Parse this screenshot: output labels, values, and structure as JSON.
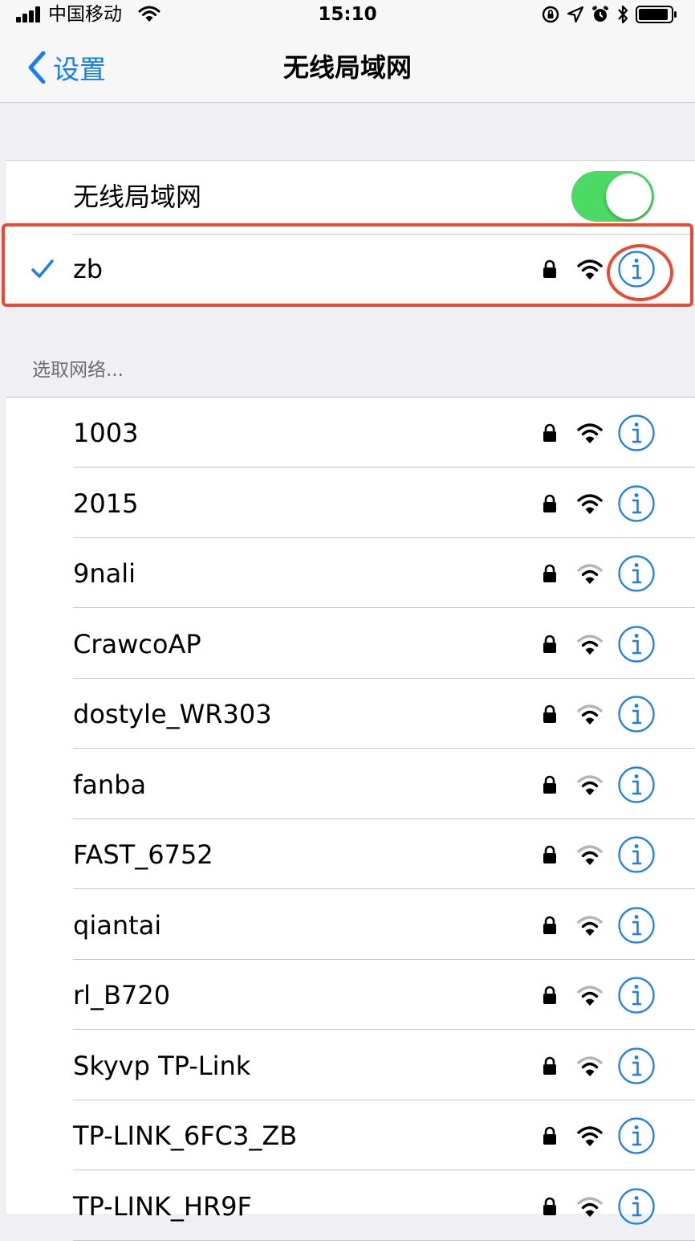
{
  "status_bar": {
    "carrier": "中国移动",
    "time": "15:10"
  },
  "nav": {
    "back_label": "设置",
    "title": "无线局域网"
  },
  "wifi_toggle": {
    "label": "无线局域网",
    "on": true
  },
  "connected_network": {
    "name": "zb",
    "secured": true,
    "signal_bars": 3
  },
  "networks_header": "选取网络...",
  "networks": [
    {
      "name": "1003",
      "secured": true,
      "signal_bars": 3
    },
    {
      "name": "2015",
      "secured": true,
      "signal_bars": 3
    },
    {
      "name": "9nali",
      "secured": true,
      "signal_bars": 2
    },
    {
      "name": "CrawcoAP",
      "secured": true,
      "signal_bars": 2
    },
    {
      "name": "dostyle_WR303",
      "secured": true,
      "signal_bars": 2
    },
    {
      "name": "fanba",
      "secured": true,
      "signal_bars": 2
    },
    {
      "name": "FAST_6752",
      "secured": true,
      "signal_bars": 2
    },
    {
      "name": "qiantai",
      "secured": true,
      "signal_bars": 2
    },
    {
      "name": "rl_B720",
      "secured": true,
      "signal_bars": 2
    },
    {
      "name": "Skyvp TP-Link",
      "secured": true,
      "signal_bars": 2
    },
    {
      "name": "TP-LINK_6FC3_ZB",
      "secured": true,
      "signal_bars": 3
    },
    {
      "name": "TP-LINK_HR9F",
      "secured": true,
      "signal_bars": 2
    }
  ],
  "colors": {
    "accent": "#147efb",
    "toggle_on": "#4cd964",
    "highlight": "#ea4a30",
    "background": "#efeff4"
  }
}
